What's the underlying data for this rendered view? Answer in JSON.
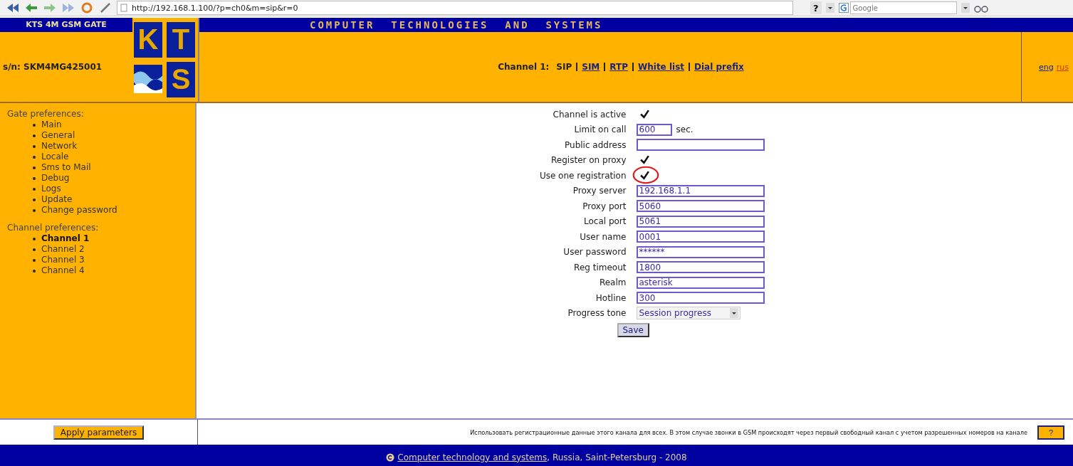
{
  "browser": {
    "url": "http://192.168.1.100/?p=ch0&m=sip&r=0",
    "help": "?",
    "search_placeholder": "Google"
  },
  "header": {
    "product": "KTS 4M GSM GATE",
    "serial": "s/n: SKM4MG425001",
    "logo_letters": [
      "K",
      "T",
      "S"
    ],
    "title": "COMPUTER  TECHNOLOGIES  AND  SYSTEMS",
    "channel_label": "Channel 1:",
    "tabs": [
      {
        "label": "SIP",
        "selected": true
      },
      {
        "label": "SIM",
        "selected": false
      },
      {
        "label": "RTP",
        "selected": false
      },
      {
        "label": "White list",
        "selected": false
      },
      {
        "label": "Dial prefix",
        "selected": false
      }
    ],
    "languages": [
      {
        "label": "eng",
        "selected": true
      },
      {
        "label": "rus",
        "selected": false
      }
    ]
  },
  "sidebar": {
    "groups": [
      {
        "title": "Gate preferences:",
        "items": [
          {
            "label": "Main",
            "selected": false
          },
          {
            "label": "General",
            "selected": false
          },
          {
            "label": "Network",
            "selected": false
          },
          {
            "label": "Locale",
            "selected": false
          },
          {
            "label": "Sms to Mail",
            "selected": false
          },
          {
            "label": "Debug",
            "selected": false
          },
          {
            "label": "Logs",
            "selected": false
          },
          {
            "label": "Update",
            "selected": false
          },
          {
            "label": "Change password",
            "selected": false
          }
        ]
      },
      {
        "title": "Channel preferences:",
        "items": [
          {
            "label": "Channel 1",
            "selected": true
          },
          {
            "label": "Channel 2",
            "selected": false
          },
          {
            "label": "Channel 3",
            "selected": false
          },
          {
            "label": "Channel 4",
            "selected": false
          }
        ]
      }
    ]
  },
  "form": {
    "rows": [
      {
        "kind": "checkbox",
        "label": "Channel is active",
        "checked": true,
        "circled": false
      },
      {
        "kind": "short",
        "label": "Limit on call",
        "value": "600",
        "unit": "sec."
      },
      {
        "kind": "text",
        "label": "Public address"
      },
      {
        "kind": "checkbox",
        "label": "Register on proxy",
        "checked": true,
        "circled": false
      },
      {
        "kind": "checkbox",
        "label": "Use one registration",
        "checked": true,
        "circled": true
      },
      {
        "kind": "text",
        "label": "Proxy server",
        "value": "192.168.1.1"
      },
      {
        "kind": "text",
        "label": "Proxy port",
        "value": "5060"
      },
      {
        "kind": "text",
        "label": "Local port",
        "value": "5061"
      },
      {
        "kind": "text",
        "label": "User name",
        "value": "0001"
      },
      {
        "kind": "text",
        "label": "User password",
        "value": "******"
      },
      {
        "kind": "text",
        "label": "Reg timeout",
        "value": "1800"
      },
      {
        "kind": "text",
        "label": "Realm",
        "value": "asterisk"
      },
      {
        "kind": "text",
        "label": "Hotline",
        "value": "300"
      },
      {
        "kind": "select",
        "label": "Progress tone",
        "value": "Session progress"
      }
    ],
    "save": "Save"
  },
  "bottom": {
    "apply": "Apply parameters",
    "hint": "Использовать регистрационные данные этого канала для всех. В этом случае звонки в GSM происходят через первый свободный канал с учетом разрешенных номеров на канале",
    "help": "?"
  },
  "footer": {
    "link": "Computer technology and systems",
    "text": ", Russia, Saint-Petersburg - 2008"
  }
}
